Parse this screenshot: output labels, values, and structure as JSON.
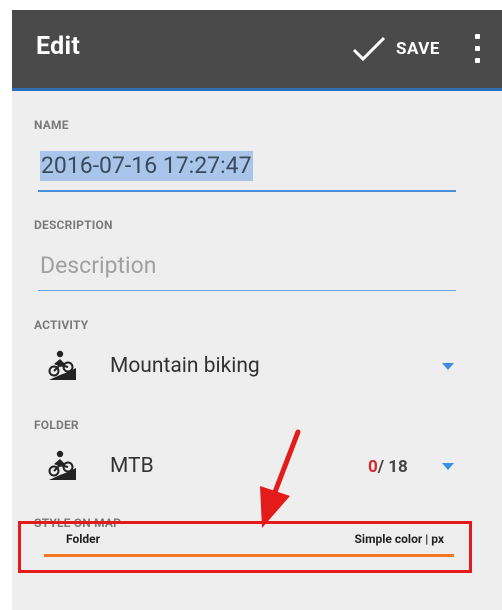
{
  "app_bar": {
    "title": "Edit",
    "save_label": "SAVE",
    "bg_color": "#4a4a4a",
    "accent_color": "#2d6db8"
  },
  "name": {
    "label": "NAME",
    "value": "2016-07-16 17:27:47"
  },
  "description": {
    "label": "DESCRIPTION",
    "placeholder": "Description",
    "value": ""
  },
  "activity": {
    "label": "ACTIVITY",
    "icon": "mountain-bike-icon",
    "selected": "Mountain biking"
  },
  "folder": {
    "label": "FOLDER",
    "icon": "mountain-bike-icon",
    "selected": "MTB",
    "count_current": "0",
    "count_total": "/ 18"
  },
  "style_on_map": {
    "label": "STYLE ON MAP",
    "source": "Folder",
    "style": "Simple color | px",
    "line_color": "#f37721"
  },
  "annotation": {
    "highlight_color": "#e41b1b"
  }
}
